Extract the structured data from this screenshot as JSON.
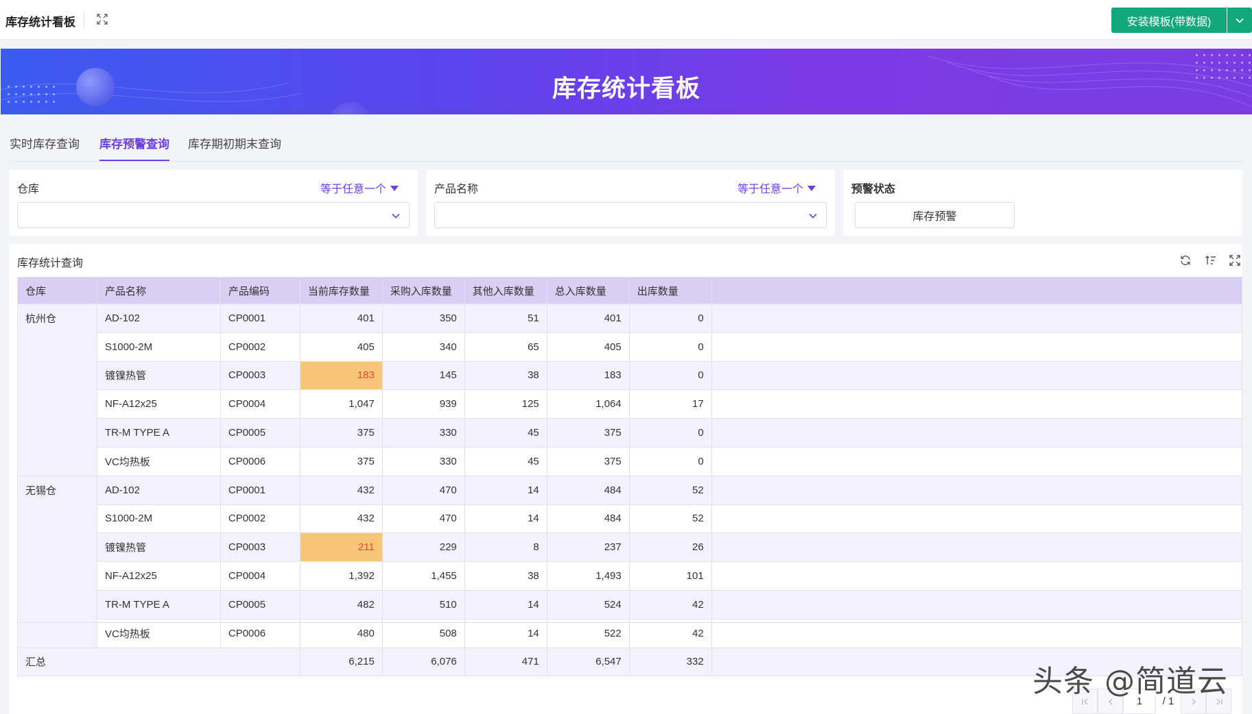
{
  "topbar": {
    "title": "库存统计看板",
    "install_button": "安装模板(带数据)"
  },
  "banner": {
    "title": "库存统计看板"
  },
  "tabs": [
    {
      "label": "实时库存查询",
      "active": false
    },
    {
      "label": "库存预警查询",
      "active": true
    },
    {
      "label": "库存期初期末查询",
      "active": false
    }
  ],
  "filters": {
    "warehouse": {
      "label": "仓库",
      "operator": "等于任意一个",
      "value": ""
    },
    "product": {
      "label": "产品名称",
      "operator": "等于任意一个",
      "value": ""
    },
    "status": {
      "label": "预警状态",
      "option": "库存预警"
    }
  },
  "panel": {
    "title": "库存统计查询"
  },
  "table": {
    "headers": [
      "仓库",
      "产品名称",
      "产品编码",
      "当前库存数量",
      "采购入库数量",
      "其他入库数量",
      "总入库数量",
      "出库数量"
    ],
    "groups": [
      {
        "warehouse": "杭州仓",
        "rows": [
          {
            "name": "AD-102",
            "code": "CP0001",
            "current": "401",
            "purchase": "350",
            "other": "51",
            "total_in": "401",
            "out": "0",
            "warn": false
          },
          {
            "name": "S1000-2M",
            "code": "CP0002",
            "current": "405",
            "purchase": "340",
            "other": "65",
            "total_in": "405",
            "out": "0",
            "warn": false
          },
          {
            "name": "镀镍热管",
            "code": "CP0003",
            "current": "183",
            "purchase": "145",
            "other": "38",
            "total_in": "183",
            "out": "0",
            "warn": true
          },
          {
            "name": "NF-A12x25",
            "code": "CP0004",
            "current": "1,047",
            "purchase": "939",
            "other": "125",
            "total_in": "1,064",
            "out": "17",
            "warn": false
          },
          {
            "name": "TR-M TYPE A",
            "code": "CP0005",
            "current": "375",
            "purchase": "330",
            "other": "45",
            "total_in": "375",
            "out": "0",
            "warn": false
          },
          {
            "name": "VC均热板",
            "code": "CP0006",
            "current": "375",
            "purchase": "330",
            "other": "45",
            "total_in": "375",
            "out": "0",
            "warn": false
          }
        ]
      },
      {
        "warehouse": "无锡仓",
        "rows": [
          {
            "name": "AD-102",
            "code": "CP0001",
            "current": "432",
            "purchase": "470",
            "other": "14",
            "total_in": "484",
            "out": "52",
            "warn": false
          },
          {
            "name": "S1000-2M",
            "code": "CP0002",
            "current": "432",
            "purchase": "470",
            "other": "14",
            "total_in": "484",
            "out": "52",
            "warn": false
          },
          {
            "name": "镀镍热管",
            "code": "CP0003",
            "current": "211",
            "purchase": "229",
            "other": "8",
            "total_in": "237",
            "out": "26",
            "warn": true
          },
          {
            "name": "NF-A12x25",
            "code": "CP0004",
            "current": "1,392",
            "purchase": "1,455",
            "other": "38",
            "total_in": "1,493",
            "out": "101",
            "warn": false
          },
          {
            "name": "TR-M TYPE A",
            "code": "CP0005",
            "current": "482",
            "purchase": "510",
            "other": "14",
            "total_in": "524",
            "out": "42",
            "warn": false
          },
          {
            "name": "VC均热板",
            "code": "CP0006",
            "current": "480",
            "purchase": "508",
            "other": "14",
            "total_in": "522",
            "out": "42",
            "warn": false
          }
        ]
      }
    ],
    "summary": {
      "label": "汇总",
      "current": "6,215",
      "purchase": "6,076",
      "other": "471",
      "total_in": "6,547",
      "out": "332"
    }
  },
  "pagination": {
    "page": "1",
    "total": "/ 1"
  },
  "watermark": "头条 @简道云",
  "colors": {
    "accent": "#6b3fe0",
    "install": "#12a77d",
    "header_bg": "#d8cff3",
    "warn_bg": "#f8c67b",
    "warn_text": "#e0492f"
  }
}
